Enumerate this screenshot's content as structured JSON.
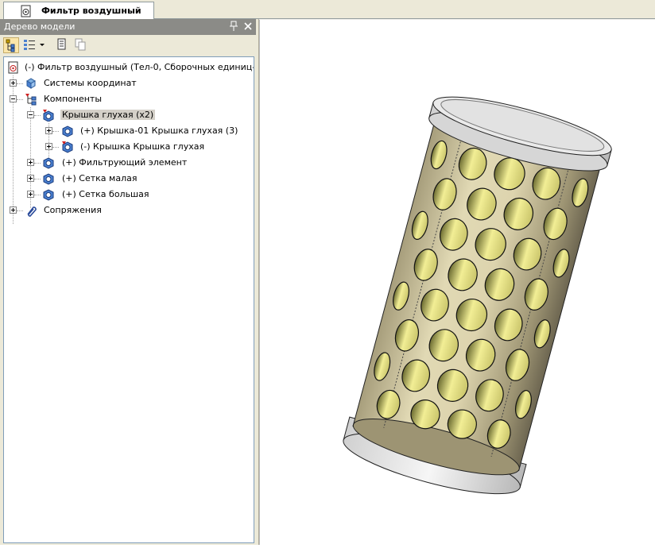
{
  "document_tab": {
    "title": "Фильтр воздушный",
    "icon": "assembly-document-icon"
  },
  "panel": {
    "title": "Дерево модели",
    "pin_icon": "pin-icon",
    "close_icon": "close-icon",
    "toolbar": [
      {
        "name": "tree-structure-button",
        "icon": "tree-structure-icon",
        "active": true
      },
      {
        "name": "display-mode-dropdown",
        "icon": "list-view-icon"
      },
      {
        "name": "properties-button",
        "icon": "properties-icon"
      },
      {
        "name": "copy-properties-button",
        "icon": "copy-icon"
      }
    ]
  },
  "tree": {
    "root": {
      "label": "(-) Фильтр воздушный (Тел-0, Сборочных единиц-0, Де",
      "icon": "assembly-root-icon"
    },
    "items": [
      {
        "label": "Системы координат",
        "icon": "coordinate-system-icon",
        "expander": "plus"
      },
      {
        "label": "Компоненты",
        "icon": "components-icon",
        "expander": "minus"
      },
      {
        "label": "Крышка глухая (x2)",
        "icon": "part-group-icon",
        "expander": "minus",
        "selected": true
      },
      {
        "label": "(+) Крышка-01 Крышка глухая (3)",
        "icon": "part-icon",
        "expander": "plus"
      },
      {
        "label": "(-) Крышка Крышка глухая",
        "icon": "part-icon",
        "expander": "plus"
      },
      {
        "label": "(+) Фильтрующий элемент",
        "icon": "part-icon",
        "expander": "plus"
      },
      {
        "label": "(+) Сетка малая",
        "icon": "part-icon",
        "expander": "plus"
      },
      {
        "label": "(+) Сетка большая",
        "icon": "part-icon",
        "expander": "plus"
      },
      {
        "label": "Сопряжения",
        "icon": "mates-icon",
        "expander": "plus"
      }
    ]
  },
  "viewport": {
    "model": "perforated-cylinder-model",
    "colors": {
      "body": "#d8cfa6",
      "caps": "#e8e8e8",
      "holes": "#e8e48a"
    }
  }
}
